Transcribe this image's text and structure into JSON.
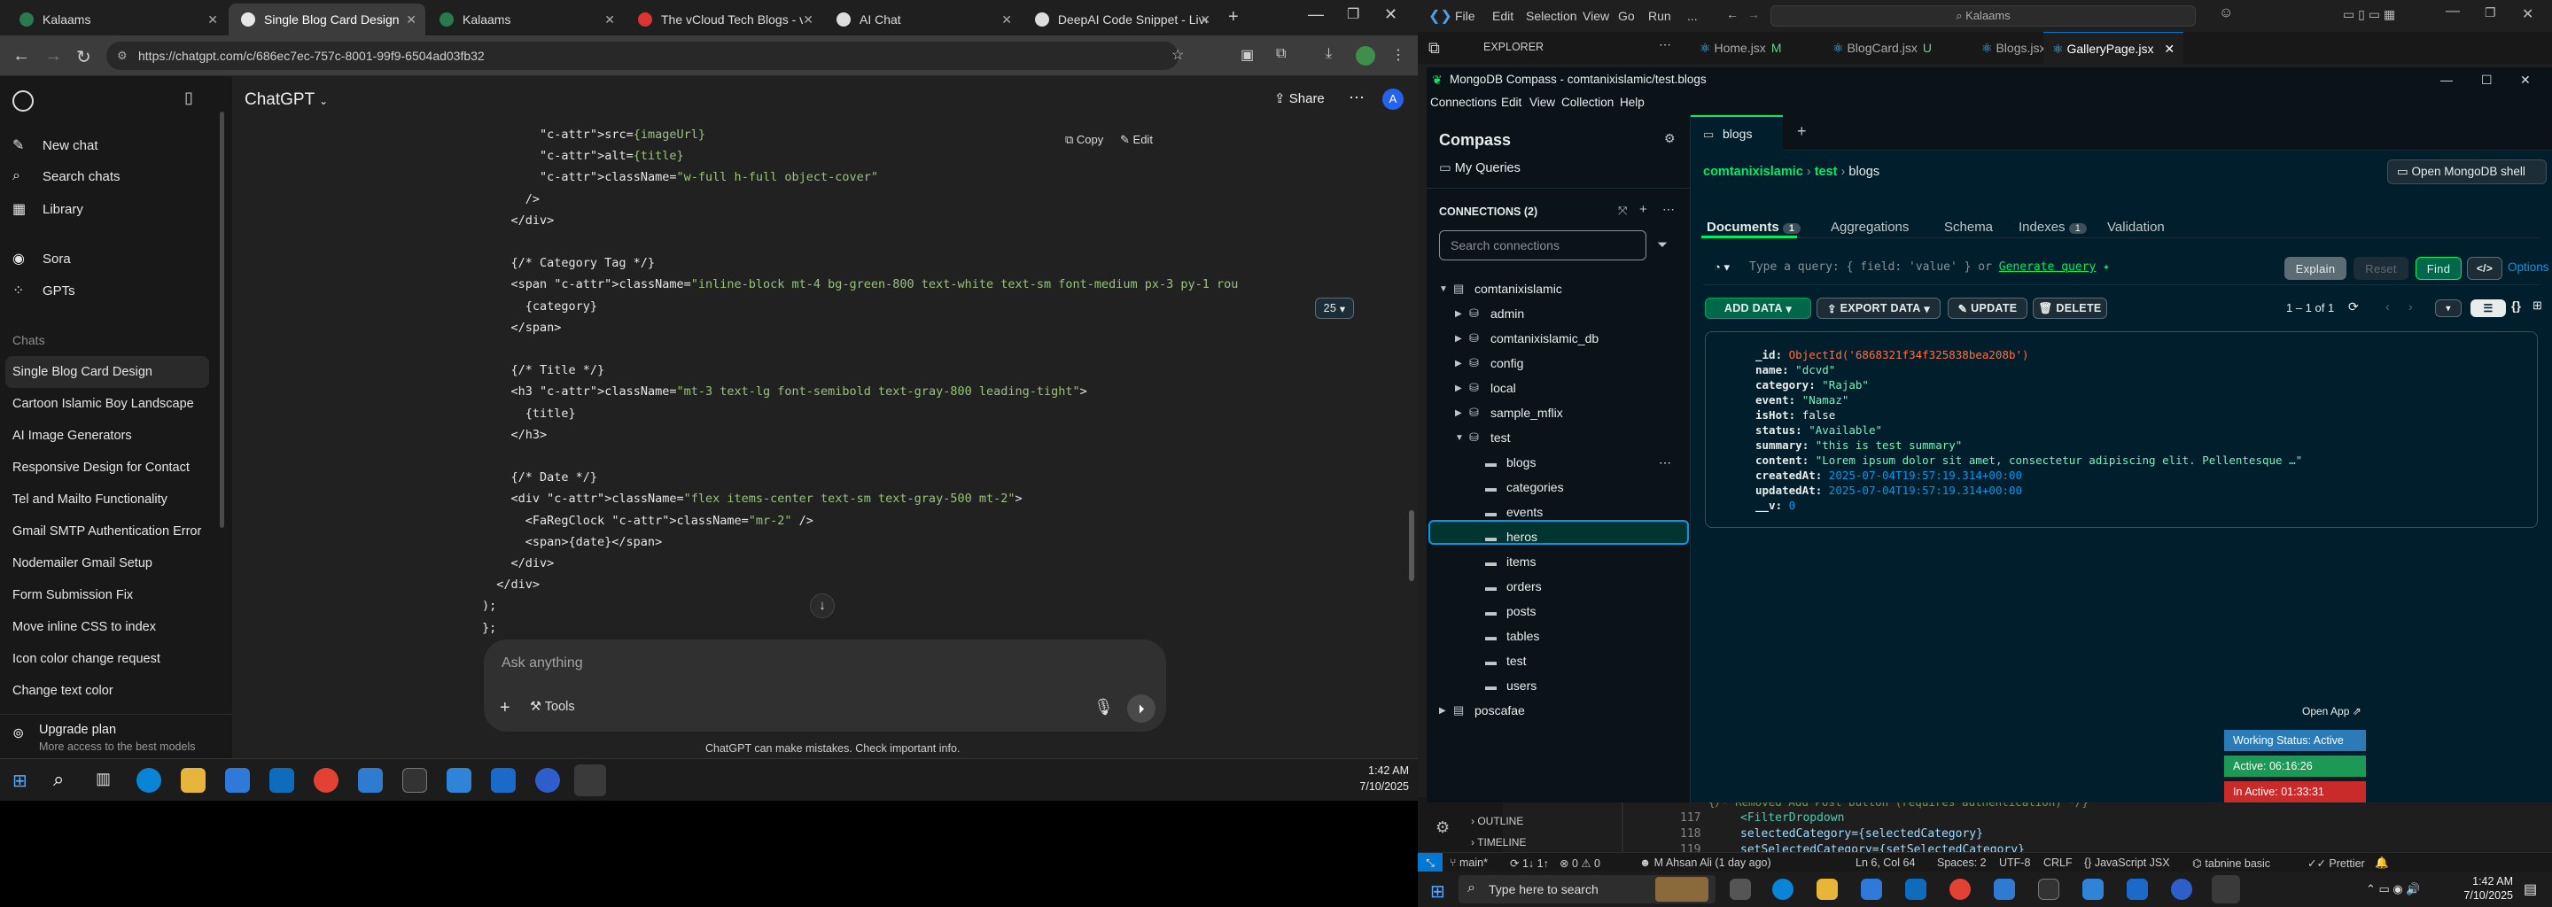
{
  "browser": {
    "tabs": [
      {
        "label": "Kalaams"
      },
      {
        "label": "Single Blog Card Design"
      },
      {
        "label": "Kalaams"
      },
      {
        "label": "The vCloud Tech Blogs - vCl"
      },
      {
        "label": "AI Chat"
      },
      {
        "label": "DeepAI Code Snippet - Live"
      }
    ],
    "url": "https://chatgpt.com/c/686ec7ec-757c-8001-99f9-6504ad03fb32"
  },
  "chatgpt": {
    "header_title": "ChatGPT",
    "share_label": "Share",
    "avatar_letter": "A",
    "nav": [
      {
        "label": "New chat"
      },
      {
        "label": "Search chats"
      },
      {
        "label": "Library"
      },
      {
        "label": "Sora"
      },
      {
        "label": "GPTs"
      }
    ],
    "chats_heading": "Chats",
    "chats": [
      "Single Blog Card Design",
      "Cartoon Islamic Boy Landscape",
      "AI Image Generators",
      "Responsive Design for Contact",
      "Tel and Mailto Functionality",
      "Gmail SMTP Authentication Error",
      "Nodemailer Gmail Setup",
      "Form Submission Fix",
      "Move inline CSS to index",
      "Icon color change request",
      "Change text color"
    ],
    "upgrade": {
      "title": "Upgrade plan",
      "subtitle": "More access to the best models"
    },
    "code_copy": "Copy",
    "code_edit": "Edit",
    "code_lines": [
      "        src={imageUrl}",
      "        alt={title}",
      "        className=\"w-full h-full object-cover\"",
      "      />",
      "    </div>",
      "",
      "    {/* Category Tag */}",
      "    <span className=\"inline-block mt-4 bg-green-800 text-white text-sm font-medium px-3 py-1 rou",
      "      {category}",
      "    </span>",
      "",
      "    {/* Title */}",
      "    <h3 className=\"mt-3 text-lg font-semibold text-gray-800 leading-tight\">",
      "      {title}",
      "    </h3>",
      "",
      "    {/* Date */}",
      "    <div className=\"flex items-center text-sm text-gray-500 mt-2\">",
      "      <FaRegClock className=\"mr-2\" />",
      "      <span>{date}</span>",
      "    </div>",
      "  </div>",
      ");",
      "};"
    ],
    "composer_placeholder": "Ask anything",
    "tools_label": "Tools",
    "disclaimer": "ChatGPT can make mistakes. Check important info."
  },
  "taskbar_left": {
    "time": "1:42 AM",
    "date": "7/10/2025"
  },
  "vscode": {
    "menu": [
      "File",
      "Edit",
      "Selection",
      "View",
      "Go",
      "Run",
      "..."
    ],
    "search": "Kalaams",
    "explorer_label": "EXPLORER",
    "tabs": [
      {
        "label": "Home.jsx",
        "suffix": "M"
      },
      {
        "label": "BlogCard.jsx",
        "suffix": "U"
      },
      {
        "label": "Blogs.jsx",
        "suffix": "M"
      },
      {
        "label": "GalleryPage.jsx",
        "suffix": ""
      }
    ],
    "code_peek": [
      {
        "num": "117",
        "text": "<FilterDropdown"
      },
      {
        "num": "118",
        "text": "  selectedCategory={selectedCategory}"
      },
      {
        "num": "119",
        "text": "  setSelectedCategory={setSelectedCategory}"
      }
    ],
    "peek_comment": "{/* Removed Add Post button (requires authentication) */}",
    "outline_label": "OUTLINE",
    "timeline_label": "TIMELINE",
    "status_left": [
      "main*",
      "1↓ 1↑",
      "⊗ 0 ⚠ 0",
      "M Ahsan Ali (1 day ago)"
    ],
    "status_right": [
      "Ln 6, Col 64",
      "Spaces: 2",
      "UTF-8",
      "CRLF",
      "JavaScript JSX",
      "tabnine basic",
      "Prettier"
    ]
  },
  "compass": {
    "window_title": "MongoDB Compass - comtanixislamic/test.blogs",
    "menu": [
      "Connections",
      "Edit",
      "View",
      "Collection",
      "Help"
    ],
    "brand": "Compass",
    "my_queries": "My Queries",
    "connections_label": "CONNECTIONS (2)",
    "search_placeholder": "Search connections",
    "tree": [
      {
        "label": "comtanixislamic",
        "level": 0,
        "open": true
      },
      {
        "label": "admin",
        "level": 1
      },
      {
        "label": "comtanixislamic_db",
        "level": 1
      },
      {
        "label": "config",
        "level": 1
      },
      {
        "label": "local",
        "level": 1
      },
      {
        "label": "sample_mflix",
        "level": 1
      },
      {
        "label": "test",
        "level": 1,
        "open": true
      },
      {
        "label": "blogs",
        "level": 2,
        "selected": true
      },
      {
        "label": "categories",
        "level": 2
      },
      {
        "label": "events",
        "level": 2
      },
      {
        "label": "heros",
        "level": 2
      },
      {
        "label": "items",
        "level": 2
      },
      {
        "label": "orders",
        "level": 2
      },
      {
        "label": "posts",
        "level": 2
      },
      {
        "label": "tables",
        "level": 2
      },
      {
        "label": "test",
        "level": 2
      },
      {
        "label": "users",
        "level": 2
      },
      {
        "label": "poscafae",
        "level": 0
      }
    ],
    "tab_name": "blogs",
    "breadcrumb": {
      "db": "comtanixislamic",
      "coll_db": "test",
      "coll": "blogs"
    },
    "open_shell": "Open MongoDB shell",
    "tabs": [
      {
        "label": "Documents",
        "badge": "1"
      },
      {
        "label": "Aggregations",
        "badge": ""
      },
      {
        "label": "Schema",
        "badge": ""
      },
      {
        "label": "Indexes",
        "badge": "1"
      },
      {
        "label": "Validation",
        "badge": ""
      }
    ],
    "query_placeholder": "Type a query: { field: 'value' } or",
    "generate_query": "Generate query",
    "explain": "Explain",
    "reset": "Reset",
    "find": "Find",
    "options": "Options",
    "add_data": "ADD DATA",
    "export_data": "EXPORT DATA",
    "update": "UPDATE",
    "delete": "DELETE",
    "page_size": "25",
    "range": "1 – 1 of 1",
    "document": [
      {
        "key": "_id",
        "value": "ObjectId('6868321f34f325838bea208b')",
        "type": "oid"
      },
      {
        "key": "name",
        "value": "\"dcvd\"",
        "type": "str"
      },
      {
        "key": "category",
        "value": "\"Rajab\"",
        "type": "str"
      },
      {
        "key": "event",
        "value": "\"Namaz\"",
        "type": "str"
      },
      {
        "key": "isHot",
        "value": "false",
        "type": "bool"
      },
      {
        "key": "status",
        "value": "\"Available\"",
        "type": "str"
      },
      {
        "key": "summary",
        "value": "\"this is test summary\"",
        "type": "str"
      },
      {
        "key": "content",
        "value": "\"Lorem ipsum dolor sit amet, consectetur adipiscing elit. Pellentesque …\"",
        "type": "str"
      },
      {
        "key": "createdAt",
        "value": "2025-07-04T19:57:19.314+00:00",
        "type": "date"
      },
      {
        "key": "updatedAt",
        "value": "2025-07-04T19:57:19.314+00:00",
        "type": "date"
      },
      {
        "key": "__v",
        "value": "0",
        "type": "num"
      }
    ]
  },
  "status_widget": {
    "open_app": "Open App",
    "working": "Working Status: Active",
    "active": "Active: 06:16:26",
    "inactive": "In Active: 01:33:31"
  },
  "taskbar_right": {
    "search_placeholder": "Type here to search",
    "time": "1:42 AM",
    "date": "7/10/2025"
  },
  "colors": {
    "compass_bg": "#001e2b",
    "compass_green": "#00ed64",
    "compass_btn": "#00684a",
    "widget_blue": "#2b7bb9",
    "widget_green": "#1c9a55",
    "widget_red": "#c92a2a"
  }
}
